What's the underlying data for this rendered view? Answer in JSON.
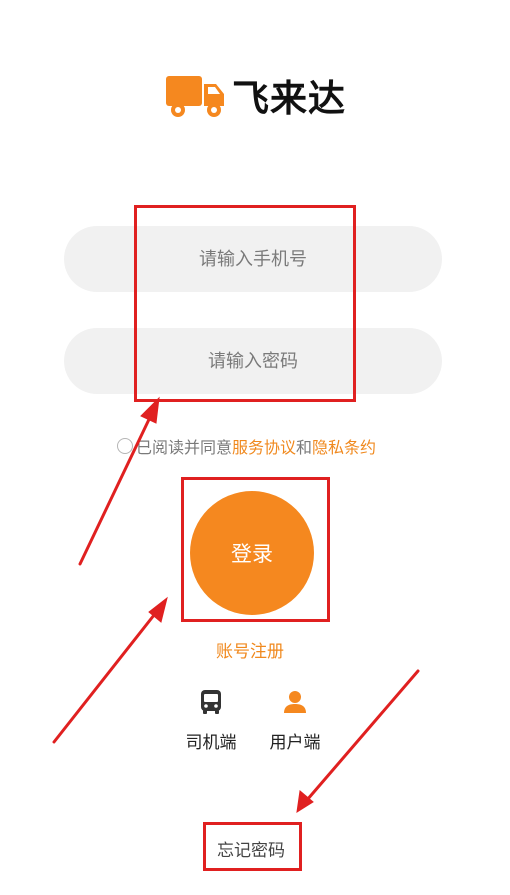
{
  "app": {
    "name": "飞来达",
    "logo_icon": "truck-icon",
    "accent_color": "#f5881f"
  },
  "login_form": {
    "phone_placeholder": "请输入手机号",
    "password_placeholder": "请输入密码",
    "agreement": {
      "prefix": "已阅读并同意",
      "service_terms": "服务协议",
      "conjunction": "和",
      "privacy_terms": "隐私条约"
    },
    "login_label": "登录",
    "register_label": "账号注册",
    "forgot_password_label": "忘记密码"
  },
  "roles": [
    {
      "label": "司机端",
      "icon": "bus-icon"
    },
    {
      "label": "用户端",
      "icon": "user-icon"
    }
  ],
  "annotations": {
    "highlight_color": "#e02020"
  }
}
